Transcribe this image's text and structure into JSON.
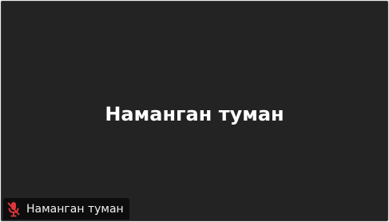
{
  "participant": {
    "display_name": "Наманган туман",
    "name_tag": "Наманган туман",
    "mic_icon": "microphone-muted-icon",
    "mic_color": "#e0363b",
    "tile_background": "#232323"
  }
}
